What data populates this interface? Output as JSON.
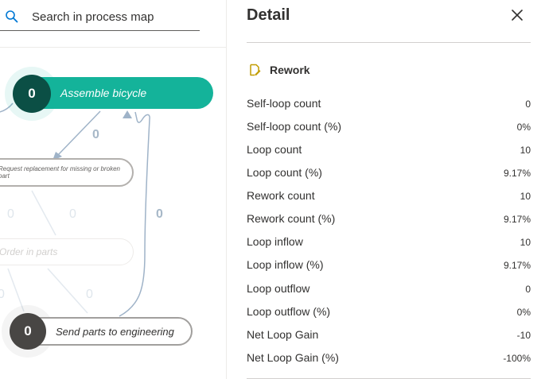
{
  "search": {
    "placeholder": "Search in process map"
  },
  "map": {
    "nodes": [
      {
        "id": "assemble",
        "label": "Assemble bicycle",
        "count": "0"
      },
      {
        "id": "request",
        "label": "Request replacement for missing or broken part"
      },
      {
        "id": "order",
        "label": "Order in parts"
      },
      {
        "id": "send",
        "label": "Send parts to engineering",
        "count": "0"
      }
    ],
    "edge_labels": [
      "0",
      "0",
      "0",
      "0",
      "0",
      "0",
      "0"
    ]
  },
  "detail": {
    "title": "Detail",
    "section": "Rework",
    "metrics": [
      {
        "label": "Self-loop count",
        "value": "0"
      },
      {
        "label": "Self-loop count (%)",
        "value": "0%"
      },
      {
        "label": "Loop count",
        "value": "10"
      },
      {
        "label": "Loop count (%)",
        "value": "9.17%"
      },
      {
        "label": "Rework count",
        "value": "10"
      },
      {
        "label": "Rework count (%)",
        "value": "9.17%"
      },
      {
        "label": "Loop inflow",
        "value": "10"
      },
      {
        "label": "Loop inflow (%)",
        "value": "9.17%"
      },
      {
        "label": "Loop outflow",
        "value": "0"
      },
      {
        "label": "Loop outflow (%)",
        "value": "0%"
      },
      {
        "label": "Net Loop Gain",
        "value": "-10"
      },
      {
        "label": "Net Loop Gain (%)",
        "value": "-100%"
      }
    ]
  },
  "colors": {
    "accent": "#14b39a",
    "node_dark": "#0b4f45",
    "node_gray": "#484644",
    "edge": "#9fb3c8"
  }
}
